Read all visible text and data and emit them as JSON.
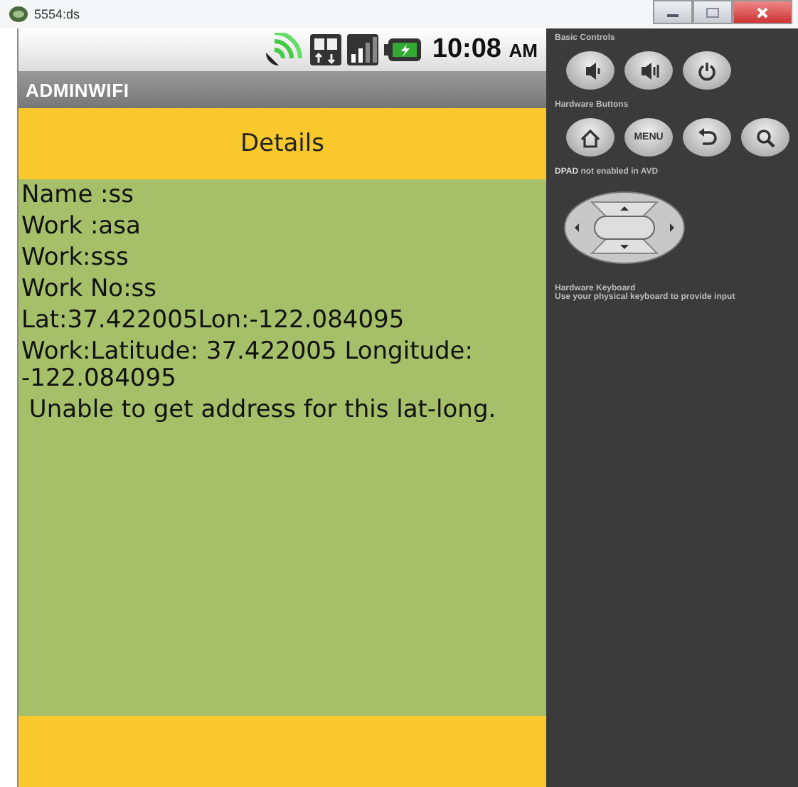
{
  "window": {
    "title": "5554:ds"
  },
  "status_bar": {
    "time": "10:08",
    "meridiem": "AM"
  },
  "app_bar": {
    "title": "ADMINWIFI"
  },
  "header": {
    "title": "Details"
  },
  "details": [
    {
      "text": "Name :ss"
    },
    {
      "text": "Work :asa"
    },
    {
      "text": "Work:sss"
    },
    {
      "text": "Work No:ss"
    },
    {
      "text": "Lat:37.422005Lon:-122.084095"
    },
    {
      "text": "Work:Latitude: 37.422005 Longitude: -122.084095"
    },
    {
      "text": " Unable to get address for this lat-long."
    }
  ],
  "controls": {
    "basic_title": "Basic Controls",
    "basic_buttons": [
      {
        "kind": "volume-down"
      },
      {
        "kind": "volume-up"
      },
      {
        "kind": "power"
      }
    ],
    "hardware_title": "Hardware Buttons",
    "hardware_buttons": [
      {
        "kind": "home"
      },
      {
        "kind": "menu",
        "label": "MENU"
      },
      {
        "kind": "back"
      },
      {
        "kind": "search"
      }
    ],
    "dpad_note": "**DPAD** not enabled in AVD",
    "keyboard_title": "Hardware Keyboard",
    "keyboard_note": "Use your physical keyboard to provide input"
  }
}
